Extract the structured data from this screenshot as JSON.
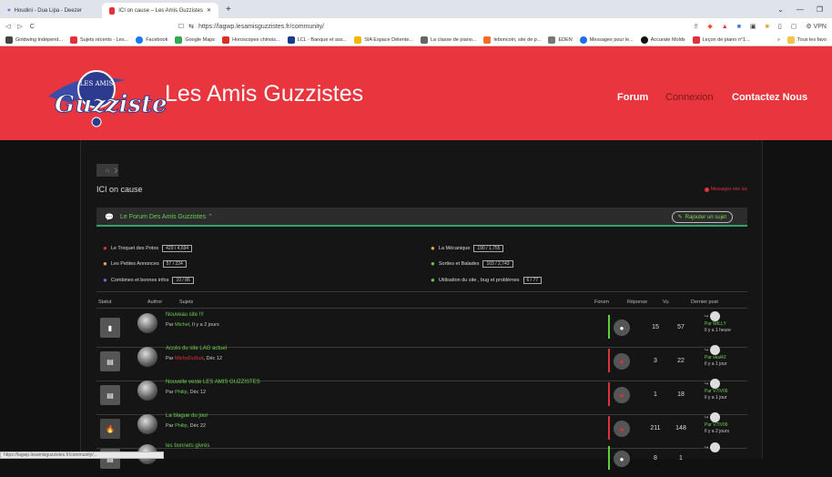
{
  "browser": {
    "tabs": [
      {
        "label": "Houdini - Dua Lipa - Deezer",
        "active": false
      },
      {
        "label": "ICI on cause – Les Amis Guzzistes",
        "active": true
      }
    ],
    "url": "https://lagwp.lesamisguzzistes.fr/community/",
    "vpn_label": "VPN",
    "bookmarks": [
      "Goldwing Indépend...",
      "Sujets récents - Les...",
      "Facebook",
      "Google Maps",
      "Horoscopes chinois...",
      "LCL - Banque et ass...",
      "SIA Espace Détente...",
      "La classe de piano...",
      "leboncoin, site de p...",
      "EDEN",
      "Messages pour le...",
      "Accurate Molds",
      "Leçon de piano n°1..."
    ],
    "bookmarks_more": "»",
    "all_bookmarks": "Tous les favo",
    "status_url": "https://lagwp.lesamisguzzistes.fr/community/..."
  },
  "site": {
    "title": "Les Amis Guzzistes",
    "logo_text": "Guzzistes",
    "logo_badge": "LES AMIS",
    "menu": [
      "Forum",
      "Connexion",
      "Contactez Nous"
    ]
  },
  "page": {
    "title": "ICI on cause",
    "unread_label": "Messages non lus",
    "forum_name": "Le Forum Des Amis Guzzistes",
    "add_topic": "Rajouter un sujet",
    "subforums": [
      {
        "name": "Le Troquet des Potos",
        "count": "429 / 4,694",
        "color": "#e0323a"
      },
      {
        "name": "La Mécanique",
        "count": "190 / 1,755",
        "color": "#e8a838"
      },
      {
        "name": "Les Petites Annonces",
        "count": "57 / 224",
        "color": "#f0a060"
      },
      {
        "name": "Sorties et Balades",
        "count": "103 / 2,743",
        "color": "#5fcf3a"
      },
      {
        "name": "Combines et bonnes infos",
        "count": "10 / 86",
        "color": "#8a5ad8"
      },
      {
        "name": "Utilisation du site , bug et problèmes",
        "count": "6 / 77",
        "color": "#5fcf3a"
      }
    ],
    "columns": {
      "status": "Statut",
      "author": "Author",
      "subject": "Sujets",
      "forum": "Forum",
      "replies": "Réponse",
      "views": "Vu",
      "last": "Dernier post"
    },
    "topics": [
      {
        "title": "Nouveau site !!!",
        "by": "Par",
        "user": "Michel",
        "user_red": false,
        "date": ", Il y a 2 jours",
        "replies": "15",
        "views": "57",
        "last_user": "Par WILLY",
        "last_date": "Il y a 1 heure",
        "forum_color": "#5fcf3a",
        "hot": false
      },
      {
        "title": "Accès du site LAG actuel",
        "by": "Par",
        "user": "MicheDuSud",
        "user_red": true,
        "date": ", Déc 12",
        "replies": "3",
        "views": "22",
        "last_user": "Par skal42",
        "last_date": "Il y a 1 jour",
        "forum_color": "#e0323a",
        "hot": false
      },
      {
        "title": "Nouvelle veste LES AMIS GUZZISTES",
        "by": "Par",
        "user": "Philip",
        "user_red": false,
        "date": ", Déc 12",
        "replies": "1",
        "views": "18",
        "last_user": "Par V7IV06",
        "last_date": "Il y a 1 jour",
        "forum_color": "#e0323a",
        "hot": false
      },
      {
        "title": "La blague du jour",
        "by": "Par",
        "user": "Philip",
        "user_red": false,
        "date": ", Déc 22",
        "replies": "211",
        "views": "148",
        "last_user": "Par V7IV06",
        "last_date": "Il y a 2 jours",
        "forum_color": "#e0323a",
        "hot": true
      },
      {
        "title": "les bonnets givrés",
        "by": "",
        "user": "",
        "user_red": false,
        "date": "",
        "replies": "8",
        "views": "1",
        "last_user": "",
        "last_date": "",
        "forum_color": "#5fcf3a",
        "hot": false
      }
    ]
  }
}
